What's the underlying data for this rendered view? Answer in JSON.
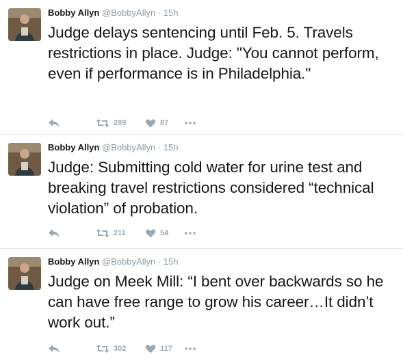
{
  "tweets": [
    {
      "name": "Bobby Allyn",
      "handle": "@BobbyAllyn",
      "separator": "·",
      "time": "15h",
      "text": "Judge delays sentencing until Feb. 5. Travels restrictions in place. Judge: \"You cannot perform, even if performance is in Philadelphia.\"",
      "retweets": "289",
      "likes": "87"
    },
    {
      "name": "Bobby Allyn",
      "handle": "@BobbyAllyn",
      "separator": "·",
      "time": "15h",
      "text": "Judge: Submitting cold water for urine test and breaking travel restrictions considered “technical violation” of probation.",
      "retweets": "211",
      "likes": "54"
    },
    {
      "name": "Bobby Allyn",
      "handle": "@BobbyAllyn",
      "separator": "·",
      "time": "15h",
      "text": "Judge on Meek Mill: “I bent over backwards so he can have free range to grow his career…It didn’t work out.”",
      "retweets": "302",
      "likes": "117"
    }
  ],
  "icons": {
    "reply": "reply-icon",
    "retweet": "retweet-icon",
    "like": "heart-icon",
    "more": "more-icon"
  },
  "colors": {
    "text": "#14171a",
    "muted": "#8899a6",
    "action": "#9aa9b6",
    "divider": "#e1e8ed"
  }
}
